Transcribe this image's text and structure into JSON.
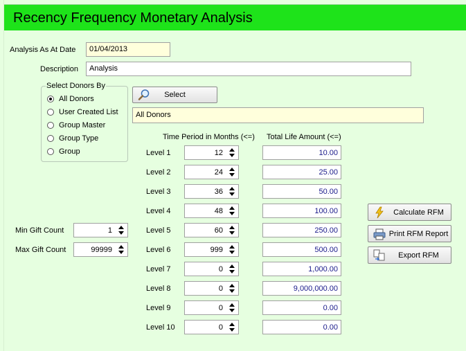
{
  "header": {
    "title": "Recency Frequency Monetary Analysis"
  },
  "form": {
    "analysis_date_label": "Analysis As At Date",
    "analysis_date_value": "01/04/2013",
    "description_label": "Description",
    "description_value": "Analysis",
    "select_group_title": "Select Donors By",
    "radio_options": [
      "All Donors",
      "User Created List",
      "Group Master",
      "Group Type",
      "Group"
    ],
    "selected_option": "All Donors",
    "select_button": "Select",
    "selection_value": "All Donors",
    "min_gift_label": "Min Gift Count",
    "min_gift_value": "1",
    "max_gift_label": "Max Gift Count",
    "max_gift_value": "99999"
  },
  "columns": {
    "time_period": "Time Period in Months (<=)",
    "total_amount": "Total Life Amount (<=)"
  },
  "levels": [
    {
      "label": "Level 1",
      "months": "12",
      "amount": "10.00"
    },
    {
      "label": "Level 2",
      "months": "24",
      "amount": "25.00"
    },
    {
      "label": "Level 3",
      "months": "36",
      "amount": "50.00"
    },
    {
      "label": "Level 4",
      "months": "48",
      "amount": "100.00"
    },
    {
      "label": "Level 5",
      "months": "60",
      "amount": "250.00"
    },
    {
      "label": "Level 6",
      "months": "999",
      "amount": "500.00"
    },
    {
      "label": "Level 7",
      "months": "0",
      "amount": "1,000.00"
    },
    {
      "label": "Level 8",
      "months": "0",
      "amount": "9,000,000.00"
    },
    {
      "label": "Level 9",
      "months": "0",
      "amount": "0.00"
    },
    {
      "label": "Level 10",
      "months": "0",
      "amount": "0.00"
    }
  ],
  "actions": {
    "calculate": "Calculate RFM",
    "print": "Print RFM Report",
    "export": "Export RFM"
  },
  "icons": {
    "select": "magnifier-icon",
    "calculate": "lightning-icon",
    "print": "printer-icon",
    "export": "export-icon"
  },
  "colors": {
    "header": "#1ee31a",
    "background": "#e6ffe0",
    "yellow_field": "#ffffdc",
    "amount_text": "#1a1a8a"
  }
}
